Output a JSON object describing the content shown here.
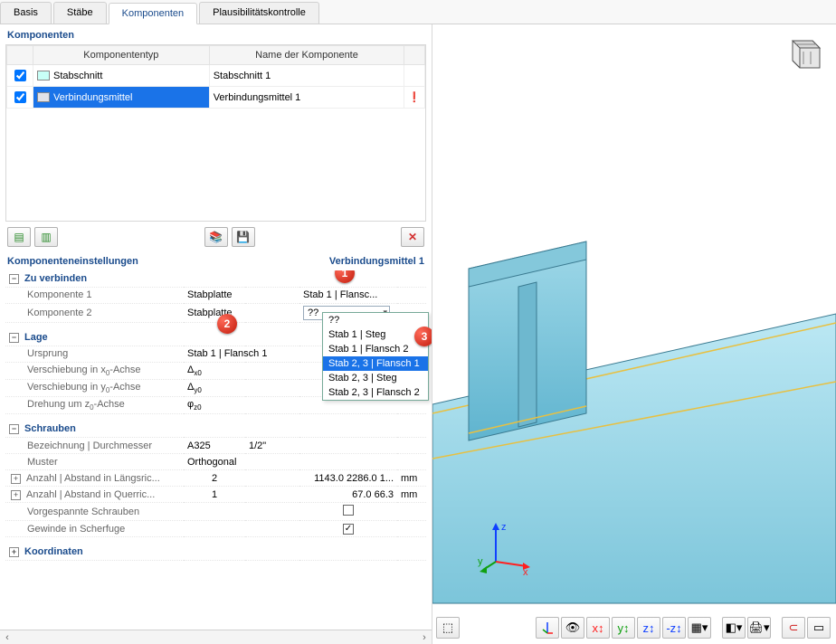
{
  "tabs": {
    "basis": "Basis",
    "staebe": "Stäbe",
    "komponenten": "Komponenten",
    "plausi": "Plausibilitätskontrolle"
  },
  "panel": {
    "title": "Komponenten",
    "col_type": "Komponententyp",
    "col_name": "Name der Komponente",
    "rows": [
      {
        "type": "Stabschnitt",
        "name": "Stabschnitt 1"
      },
      {
        "type": "Verbindungsmittel",
        "name": "Verbindungsmittel 1"
      }
    ]
  },
  "settings": {
    "header": "Komponenteneinstellungen",
    "current": "Verbindungsmittel 1",
    "g_connect": "Zu verbinden",
    "comp1": "Komponente 1",
    "comp1_v1": "Stabplatte",
    "comp1_v2": "Stab 1 | Flansc...",
    "comp2": "Komponente 2",
    "comp2_v1": "Stabplatte",
    "comp2_v2": "??",
    "g_lage": "Lage",
    "ursprung": "Ursprung",
    "ursprung_v": "Stab 1 | Flansch 1",
    "vx": "Verschiebung in x₀-Achse",
    "vx_s": "Δx0",
    "vy": "Verschiebung in y₀-Achse",
    "vy_s": "Δy0",
    "rz": "Drehung um z₀-Achse",
    "rz_s": "φz0",
    "g_schrauben": "Schrauben",
    "bez": "Bezeichnung | Durchmesser",
    "bez_v1": "A325",
    "bez_v2": "1/2\"",
    "muster": "Muster",
    "muster_v": "Orthogonal",
    "anz_l": "Anzahl | Abstand in Längsric...",
    "anz_l_n": "2",
    "anz_l_d": "1143.0 2286.0 1...",
    "unit": "mm",
    "anz_q": "Anzahl | Abstand in Querric...",
    "anz_q_n": "1",
    "anz_q_d": "67.0 66.3",
    "vorgesp": "Vorgespannte Schrauben",
    "gewinde": "Gewinde in Scherfuge",
    "g_koord": "Koordinaten"
  },
  "dropdown": {
    "items": [
      "??",
      "Stab 1 | Steg",
      "Stab 1 | Flansch 2",
      "Stab 2, 3 | Flansch 1",
      "Stab 2, 3 | Steg",
      "Stab 2, 3 | Flansch 2"
    ],
    "hl": 3
  },
  "callouts": {
    "c1": "1",
    "c2": "2",
    "c3": "3"
  },
  "axis": {
    "x": "x",
    "y": "y",
    "z": "z"
  }
}
